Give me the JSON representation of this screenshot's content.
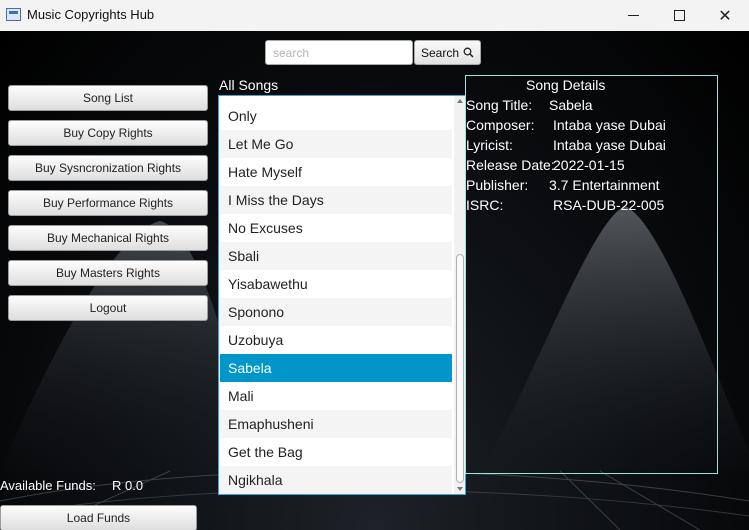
{
  "window": {
    "title": "Music Copyrights Hub"
  },
  "search": {
    "placeholder": "search",
    "value": "",
    "button_label": "Search"
  },
  "sidebar": {
    "items": [
      {
        "label": "Song List"
      },
      {
        "label": "Buy Copy Rights"
      },
      {
        "label": "Buy Sysncronization Rights"
      },
      {
        "label": "Buy Performance Rights"
      },
      {
        "label": "Buy Mechanical Rights"
      },
      {
        "label": "Buy Masters Rights"
      },
      {
        "label": "Logout"
      }
    ]
  },
  "funds": {
    "label": "Available Funds:",
    "value": "R 0.0",
    "load_label": "Load Funds"
  },
  "songs": {
    "title": "All Songs",
    "items": [
      "Only",
      "Let Me Go",
      "Hate Myself",
      "I Miss the Days",
      "No Excuses",
      "Sbali",
      "Yisabawethu",
      "Sponono",
      "Uzobuya",
      "Sabela",
      "Mali",
      "Emaphusheni",
      "Get the Bag",
      "Ngikhala"
    ],
    "selected": "Sabela"
  },
  "details": {
    "title": "Song Details",
    "fields": [
      {
        "key": "Song Title:",
        "value": "Sabela"
      },
      {
        "key": "Composer:",
        "value": "Intaba yase Dubai"
      },
      {
        "key": "Lyricist:",
        "value": "Intaba yase Dubai"
      },
      {
        "key": "Release Date:",
        "value": "2022-01-15"
      },
      {
        "key": "Publisher:",
        "value": "3.7 Entertainment"
      },
      {
        "key": "ISRC:",
        "value": "RSA-DUB-22-005"
      }
    ]
  },
  "icons": {
    "search": "search-icon",
    "minimize": "minimize-icon",
    "maximize": "maximize-icon",
    "close": "close-icon",
    "app": "app-icon"
  }
}
